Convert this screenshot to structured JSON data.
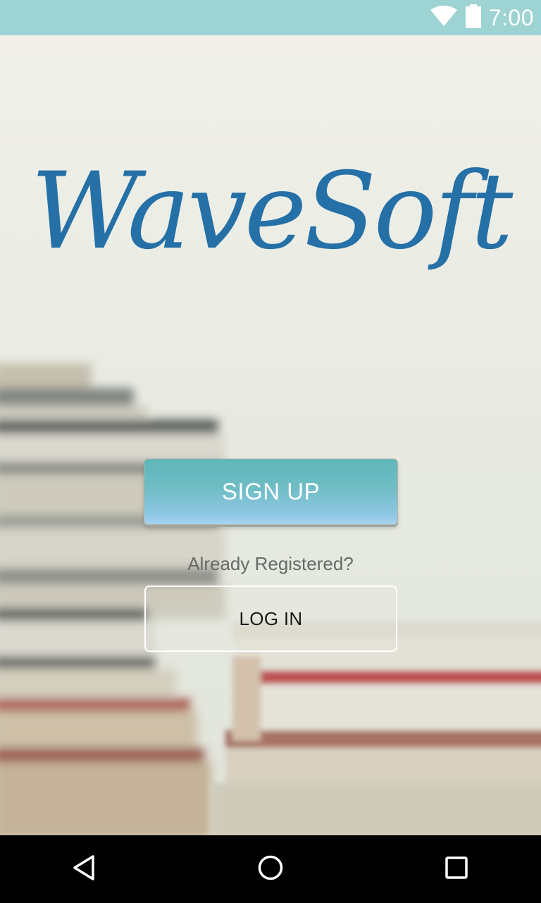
{
  "status_bar": {
    "time": "7:00",
    "icons": [
      "wifi-icon",
      "battery-icon"
    ]
  },
  "logo": {
    "text": "WaveSoft",
    "color": "#2470a7"
  },
  "buttons": {
    "signup_label": "SIGN UP",
    "already_text": "Already Registered?",
    "login_label": "LOG IN"
  },
  "nav_bar": {
    "icons": [
      "back-icon",
      "home-icon",
      "recents-icon"
    ]
  },
  "colors": {
    "status_bar": "#9dd3d3",
    "signup_gradient_top": "#5fb7ba",
    "signup_gradient_bottom": "#a7d4f0",
    "nav_bar": "#000000"
  }
}
